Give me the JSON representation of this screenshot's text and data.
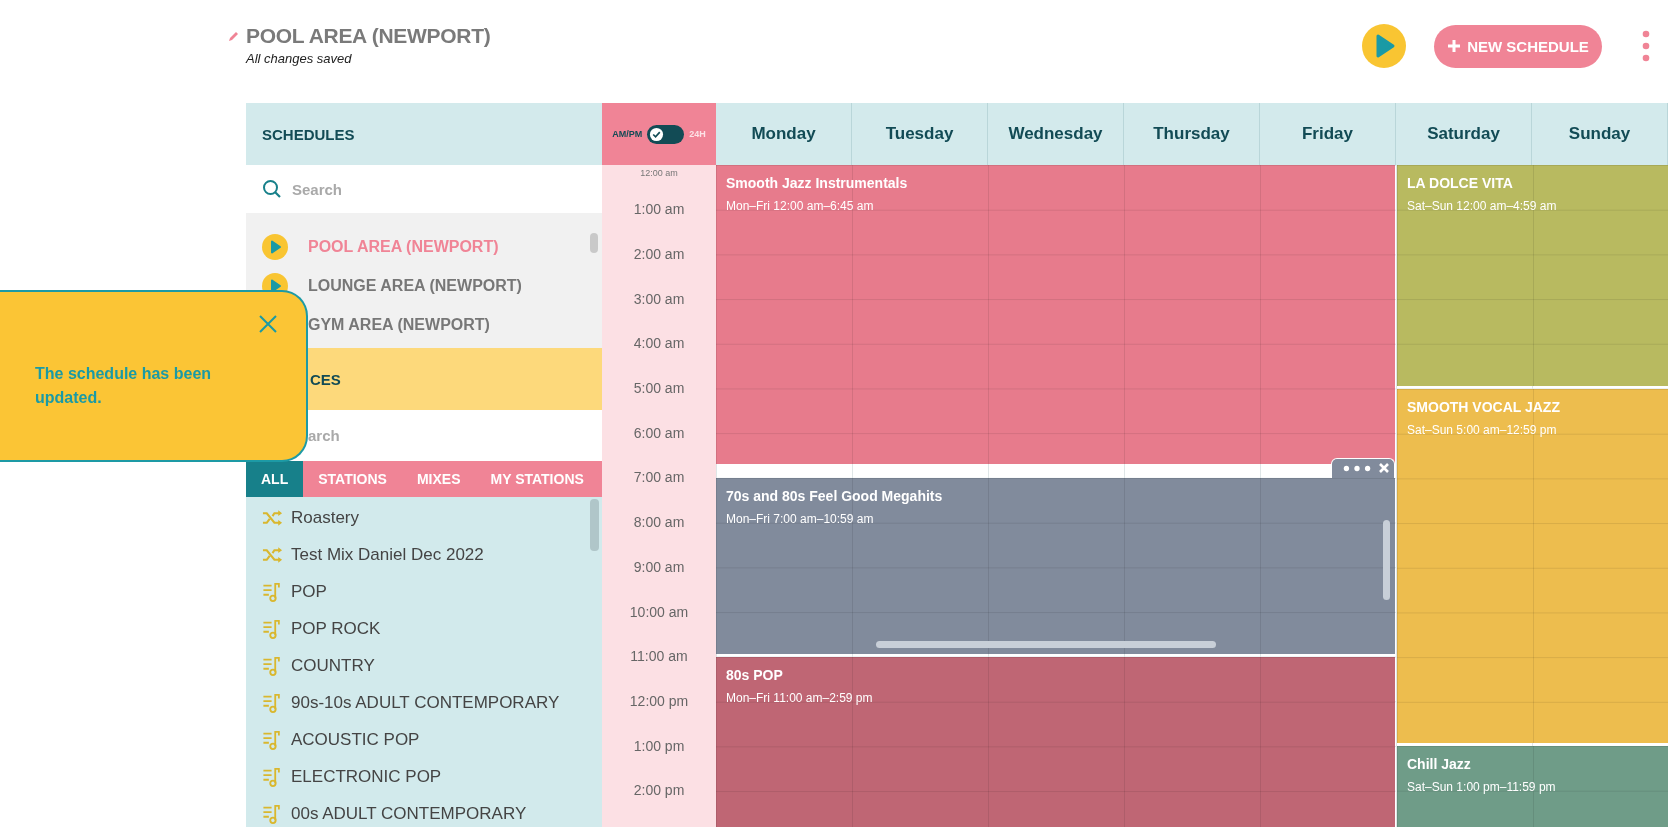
{
  "header": {
    "title": "POOL AREA (NEWPORT)",
    "status": "All changes saved",
    "new_schedule_button": "NEW SCHEDULE"
  },
  "schedules": {
    "heading": "SCHEDULES",
    "search": {
      "placeholder": "Search"
    },
    "items": [
      {
        "name": "POOL AREA (NEWPORT)",
        "selected": true
      },
      {
        "name": "LOUNGE AREA (NEWPORT)",
        "selected": false
      },
      {
        "name": "GYM AREA (NEWPORT)",
        "selected": false
      }
    ]
  },
  "sources": {
    "heading": "CES",
    "search": {
      "placeholder": "arch"
    },
    "tabs": [
      {
        "label": "ALL",
        "selected": true
      },
      {
        "label": "STATIONS",
        "selected": false
      },
      {
        "label": "MIXES",
        "selected": false
      },
      {
        "label": "MY STATIONS",
        "selected": false
      }
    ],
    "items": [
      {
        "name": "Roastery",
        "kind": "mix"
      },
      {
        "name": "Test Mix Daniel Dec 2022",
        "kind": "mix"
      },
      {
        "name": "POP",
        "kind": "station"
      },
      {
        "name": "POP ROCK",
        "kind": "station"
      },
      {
        "name": "COUNTRY",
        "kind": "station"
      },
      {
        "name": "90s-10s ADULT CONTEMPORARY",
        "kind": "station"
      },
      {
        "name": "ACOUSTIC POP",
        "kind": "station"
      },
      {
        "name": "ELECTRONIC POP",
        "kind": "station"
      },
      {
        "name": "00s ADULT CONTEMPORARY",
        "kind": "station"
      }
    ]
  },
  "time_format": {
    "label_12h": "AM/PM",
    "label_24h": "24H",
    "is_24h": false
  },
  "times": {
    "first": "12:00 am",
    "hours": [
      "1:00 am",
      "2:00 am",
      "3:00 am",
      "4:00 am",
      "5:00 am",
      "6:00 am",
      "7:00 am",
      "8:00 am",
      "9:00 am",
      "10:00 am",
      "11:00 am",
      "12:00 pm",
      "1:00 pm",
      "2:00 pm"
    ]
  },
  "days": [
    "Monday",
    "Tuesday",
    "Wednesday",
    "Thursday",
    "Friday",
    "Saturday",
    "Sunday"
  ],
  "events": {
    "weekday": [
      {
        "title": "Smooth Jazz Instrumentals",
        "time": "Mon–Fri 12:00 am–6:45 am",
        "color": "#e77b8c",
        "selected": false
      },
      {
        "title": "70s and 80s Feel Good Megahits",
        "time": "Mon–Fri 7:00 am–10:59 am",
        "color": "#818b9c",
        "selected": true
      },
      {
        "title": "80s POP",
        "time": "Mon–Fri 11:00 am–2:59 pm",
        "color": "#bf6674",
        "selected": false
      }
    ],
    "weekend": [
      {
        "title": "LA DOLCE VITA",
        "time": "Sat–Sun 12:00 am–4:59 am",
        "color": "#b8ba60",
        "selected": false
      },
      {
        "title": "SMOOTH VOCAL JAZZ",
        "time": "Sat–Sun 5:00 am–12:59 pm",
        "color": "#edbd4e",
        "selected": false
      },
      {
        "title": "Chill Jazz",
        "time": "Sat–Sun 1:00 pm–11:59 pm",
        "color": "#6f9c88",
        "selected": false
      }
    ]
  },
  "toast": {
    "message": "The schedule has been updated."
  }
}
